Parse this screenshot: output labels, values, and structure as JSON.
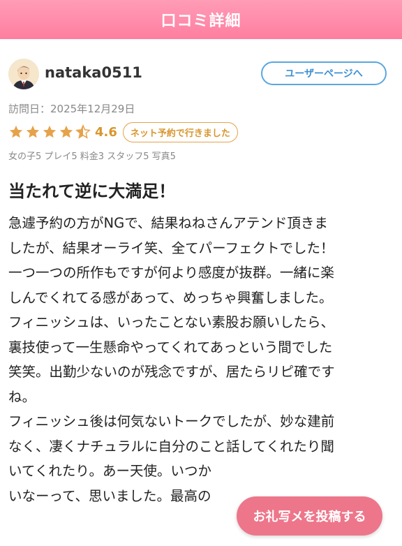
{
  "header": {
    "title": "口コミ詳細"
  },
  "user": {
    "name": "nataka0511",
    "avatar_icon": "user-avatar-icon",
    "profile_button_label": "ユーザーページへ"
  },
  "visit": {
    "text": "訪問日：2025年12月29日"
  },
  "rating": {
    "stars_filled": 4.5,
    "stars_total": 5,
    "score": "4.6",
    "badge": "ネット予約で行きました",
    "star_color": "#e6a24a"
  },
  "subscores": {
    "text": "女の子5 プレイ5 料金3 スタッフ5 写真5"
  },
  "review": {
    "title": "当たれて逆に大満足！",
    "lines": [
      "急遽予約の方がNGで、結果ねねさんアテンド頂きま",
      "したが、結果オーライ笑、全てパーフェクトでした！",
      "一つ一つの所作もですが何より感度が抜群。一緒に楽",
      "しんでくれてる感があって、めっちゃ興奮しました。",
      "フィニッシュは、いったことない素股お願いしたら、",
      "裏技使って一生懸命やってくれてあっという間でした",
      "笑笑。出勤少ないのが残念ですが、居たらリピ確です",
      "ね。",
      "フィニッシュ後は何気ないトークでしたが、妙な建前",
      "なく、凄くナチュラルに自分のこと話してくれたり聞",
      "いてくれたり。あー天使。いつか",
      "いなーって、思いました。最高の"
    ]
  },
  "floating_button": {
    "label": "お礼写メを投稿する"
  },
  "colors": {
    "header": "#ff8aa8",
    "accent_blue": "#5aa7e0",
    "accent_gold": "#e6a24a",
    "cta": "#ec6b82"
  }
}
